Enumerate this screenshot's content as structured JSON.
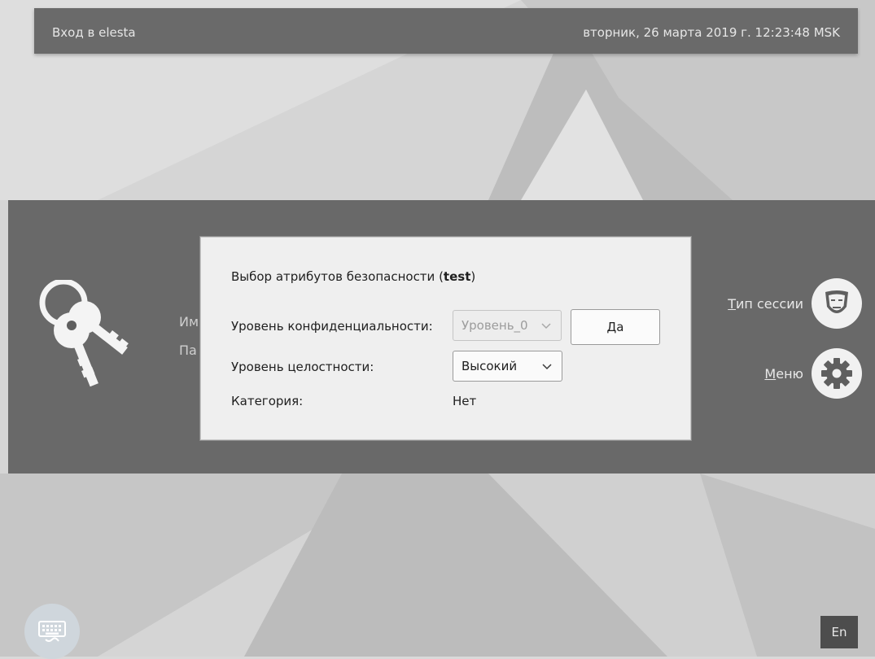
{
  "topbar": {
    "title": "Вход в elesta",
    "datetime": "вторник, 26 марта 2019 г. 12:23:48 MSK"
  },
  "login_panel": {
    "icon": "keys-icon",
    "username_label_fragment": "Им",
    "password_label_fragment": "Па",
    "session_type": {
      "label_underlined_char": "Т",
      "label_rest": "ип сессии",
      "icon": "theater-mask-icon"
    },
    "menu": {
      "label_underlined_char": "М",
      "label_rest": "еню",
      "icon": "gear-icon"
    }
  },
  "dialog": {
    "heading_prefix": "Выбор атрибутов безопасности (",
    "heading_user": "test",
    "heading_suffix": ")",
    "confidentiality": {
      "label": "Уровень конфиденциальности:",
      "value": "Уровень_0",
      "disabled": true
    },
    "integrity": {
      "label": "Уровень целостности:",
      "value": "Высокий"
    },
    "category": {
      "label": "Категория:",
      "value": "Нет"
    },
    "ok_button": "Да"
  },
  "bottom": {
    "keyboard_icon": "keyboard-icon",
    "language": "En"
  },
  "colors": {
    "topbar_bg": "#6a6a6a",
    "band_bg": "#5f5f5f",
    "dialog_bg": "#efefef",
    "icon_circle": "#f1f1f1"
  }
}
